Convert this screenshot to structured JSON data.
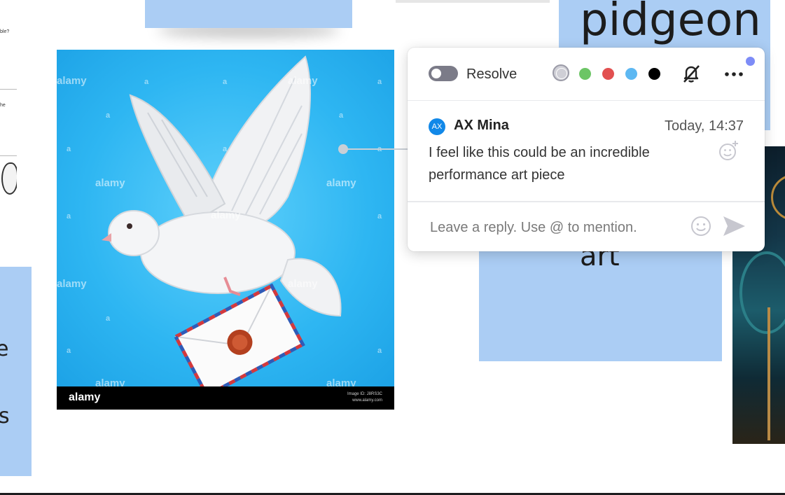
{
  "canvas": {
    "stickies": {
      "top_left": "",
      "pidgeon_text": "pidgeon",
      "art_text": "art",
      "left_t1": "e",
      "left_t2": "s"
    },
    "left_doc_snippets": [
      "ble?",
      "he"
    ],
    "image": {
      "watermark": "alamy",
      "watermark_small": "a",
      "footer_brand": "alamy",
      "footer_id_line1": "Image ID: J8RS3C",
      "footer_id_line2": "www.alamy.com"
    }
  },
  "comment": {
    "resolve_label": "Resolve",
    "colors": [
      "#cfcfd6",
      "#6cc565",
      "#e25050",
      "#5db8f2",
      "#000000"
    ],
    "author_initials": "AX",
    "author_name": "AX Mina",
    "timestamp": "Today, 14:37",
    "text": "I feel like this could be an incredible performance art piece",
    "reply_placeholder": "Leave a reply. Use @ to mention."
  }
}
